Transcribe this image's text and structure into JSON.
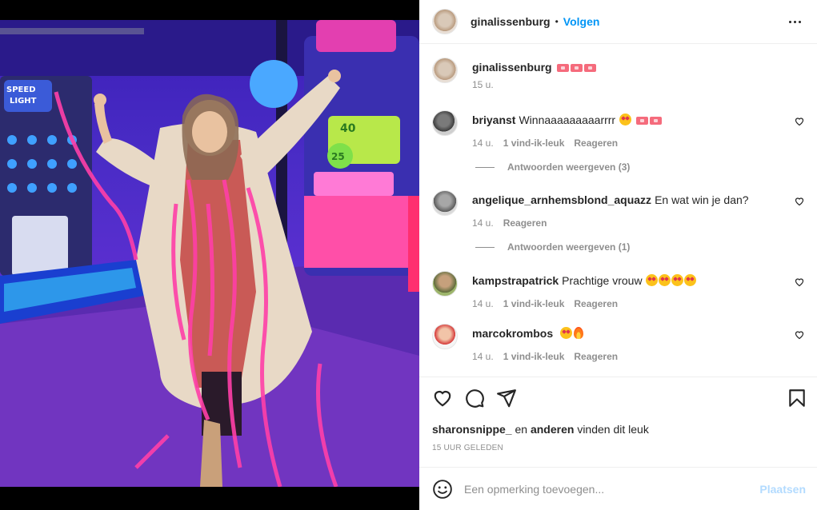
{
  "post": {
    "username": "ginalissenburg",
    "follow_label": "Volgen",
    "separator": "•"
  },
  "caption": {
    "username": "ginalissenburg",
    "time": "15 u."
  },
  "comments": [
    {
      "username": "briyanst",
      "text": "Winnaaaaaaaaarrrr",
      "time": "14 u.",
      "likes": "1 vind-ik-leuk",
      "reply": "Reageren",
      "replies_label": "Antwoorden weergeven (3)"
    },
    {
      "username": "angelique_arnhemsblond_aquazz",
      "text": "En wat win je dan?",
      "time": "14 u.",
      "reply": "Reageren",
      "replies_label": "Antwoorden weergeven (1)"
    },
    {
      "username": "kampstrapatrick",
      "text": "Prachtige vrouw",
      "time": "14 u.",
      "likes": "1 vind-ik-leuk",
      "reply": "Reageren"
    },
    {
      "username": "marcokrombos",
      "text": "",
      "time": "14 u.",
      "likes": "1 vind-ik-leuk",
      "reply": "Reageren"
    }
  ],
  "likes_line": {
    "user": "sharonsnippe_",
    "conj": "en",
    "others": "anderen",
    "suffix": "vinden dit leuk"
  },
  "timestamp": "15 UUR GELEDEN",
  "add_comment": {
    "placeholder": "Een opmerking toevoegen...",
    "post_label": "Plaatsen"
  },
  "colors": {
    "link": "#0095f6",
    "muted": "#8e8e8e",
    "post_disabled": "#b3dbff"
  },
  "icons": [
    "heart-icon",
    "comment-icon",
    "share-icon",
    "bookmark-icon",
    "smile-icon",
    "more-icon",
    "ticket-emoji",
    "heart-eyes-emoji",
    "fire-emoji"
  ]
}
